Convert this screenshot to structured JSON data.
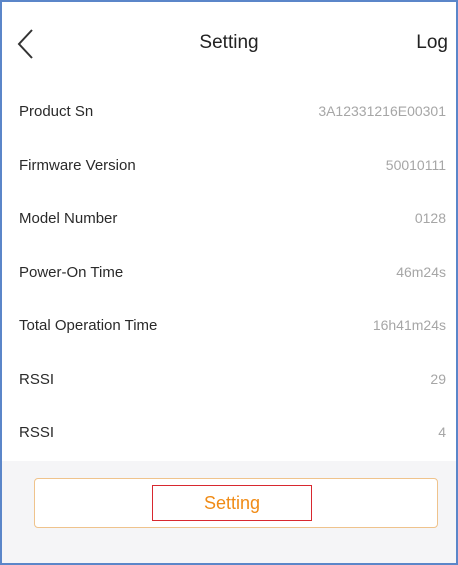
{
  "header": {
    "title": "Setting",
    "log_label": "Log"
  },
  "info_rows": [
    {
      "label": "Product Sn",
      "value": "3A12331216E00301"
    },
    {
      "label": "Firmware Version",
      "value": "50010111"
    },
    {
      "label": "Model Number",
      "value": "0128"
    },
    {
      "label": "Power-On Time",
      "value": "46m24s"
    },
    {
      "label": "Total Operation Time",
      "value": "16h41m24s"
    },
    {
      "label": "RSSI",
      "value": "29"
    },
    {
      "label": "RSSI",
      "value": "4"
    }
  ],
  "footer": {
    "setting_button_label": "Setting"
  },
  "colors": {
    "accent": "#f08b16",
    "button_border": "#efc38c",
    "highlight_box": "#d8282f",
    "value_text": "#a6a6a6"
  },
  "icons": {
    "back": "chevron-left-icon"
  }
}
